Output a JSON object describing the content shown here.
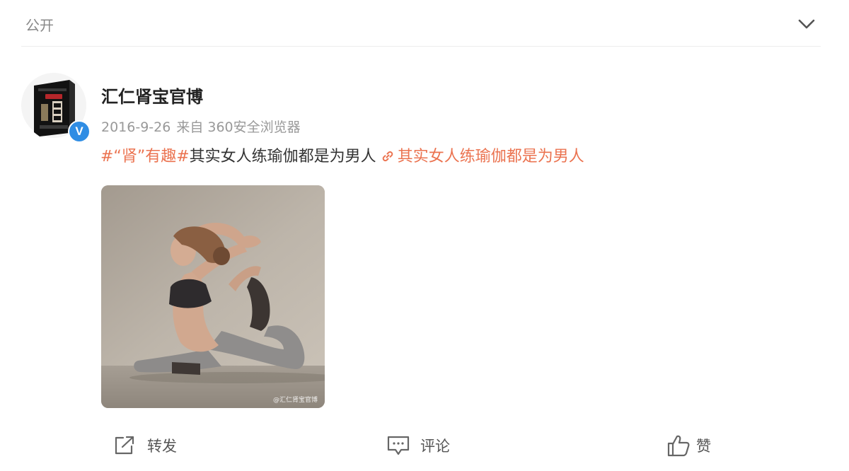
{
  "header": {
    "visibility_label": "公开",
    "collapse_icon": "chevron-down-icon"
  },
  "post": {
    "author": {
      "name": "汇仁肾宝官博",
      "verified_badge": "V"
    },
    "meta": {
      "date": "2016-9-26",
      "source": "来自 360安全浏览器"
    },
    "content": {
      "hashtag": "#“肾”有趣#",
      "text": "其实女人练瑜伽都是为男人",
      "link_text": "其实女人练瑜伽都是为男人"
    },
    "image": {
      "watermark": "@汇仁肾宝官博"
    }
  },
  "actions": {
    "repost_label": "转发",
    "comment_label": "评论",
    "like_label": "赞"
  },
  "colors": {
    "accent": "#eb7350",
    "verified": "#2f8de4",
    "muted_text": "#999999"
  }
}
